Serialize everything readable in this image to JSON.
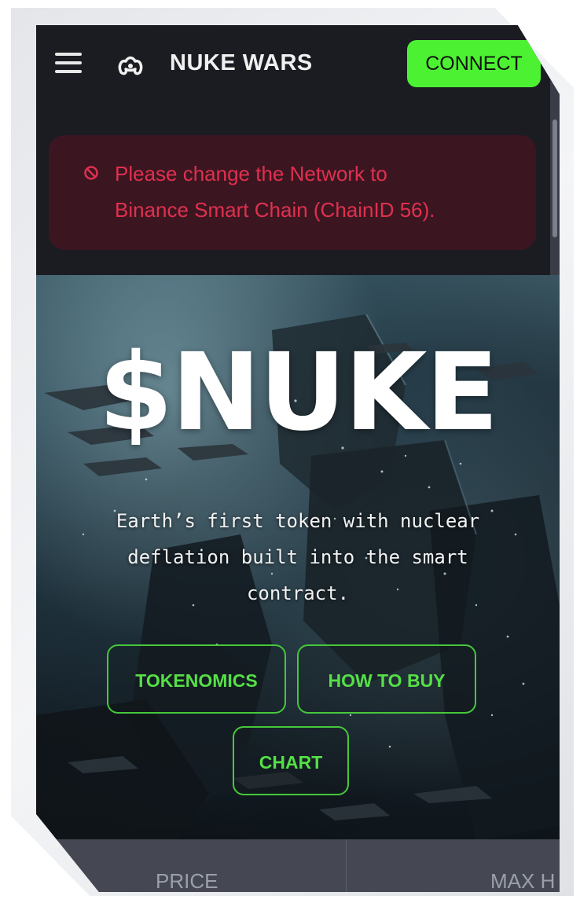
{
  "header": {
    "brand": "NUKE WARS",
    "connect_label": "CONNECT"
  },
  "alert": {
    "line1": "Please change the Network to",
    "line2": "Binance Smart Chain (ChainID 56)."
  },
  "hero": {
    "title": "$NUKE",
    "subtitle_line1": "Earth’s first token with nuclear",
    "subtitle_line2": "deflation built into the smart",
    "subtitle_line3": "contract."
  },
  "buttons": {
    "tokenomics": "TOKENOMICS",
    "how_to_buy": "HOW TO BUY",
    "chart": "CHART"
  },
  "stats": {
    "price_label": "PRICE",
    "max_label": "MAX H"
  },
  "colors": {
    "accent_green": "#4cf232",
    "alert_text": "#e0304f",
    "alert_bg": "#3b1621",
    "nav_bg": "#1b1c22"
  },
  "icons": {
    "menu": "hamburger-menu-icon",
    "logo": "nuke-wars-logo-icon",
    "alert": "prohibited-icon"
  }
}
